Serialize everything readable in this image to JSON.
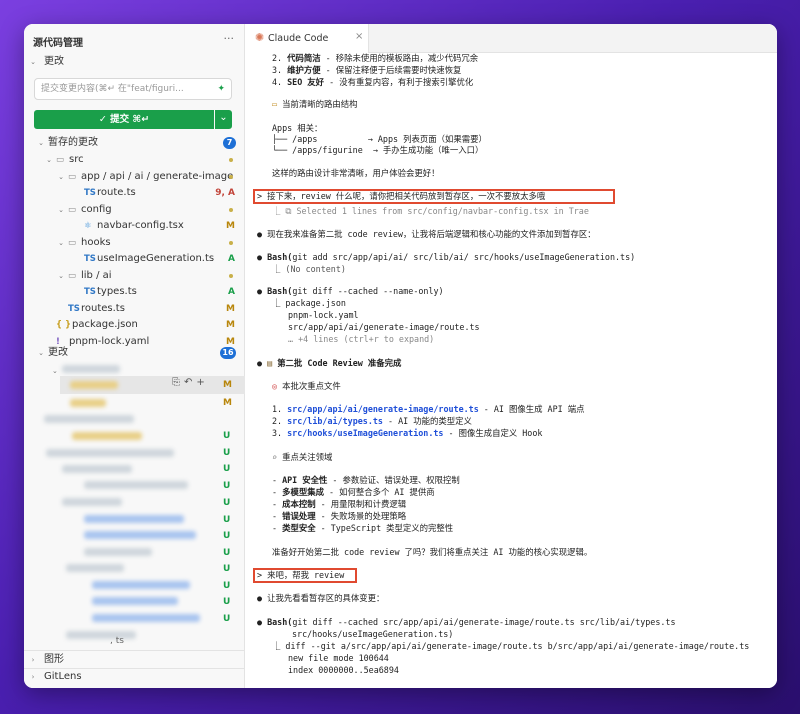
{
  "sidebar": {
    "title": "源代码管理",
    "more": "···",
    "section_changes": "更改",
    "commit_input_placeholder": "提交变更内容(⌘↵ 在\"feat/figuri...",
    "commit_button": "✓ 提交 ⌘↵",
    "commit_arrow": "⌄",
    "staged": {
      "label": "暂存的更改",
      "count": "7"
    },
    "tree": [
      {
        "name": "src",
        "kind": "folder",
        "level": 1
      },
      {
        "name": "app / api / ai / generate-image",
        "kind": "folder",
        "level": 2
      },
      {
        "name": "route.ts",
        "kind": "ts",
        "level": 3,
        "status": "9, A"
      },
      {
        "name": "config",
        "kind": "folder",
        "level": 2
      },
      {
        "name": "navbar-config.tsx",
        "kind": "tsx",
        "level": 3,
        "status": "M"
      },
      {
        "name": "hooks",
        "kind": "folder",
        "level": 2
      },
      {
        "name": "useImageGeneration.ts",
        "kind": "ts",
        "level": 3,
        "status": "A"
      },
      {
        "name": "lib / ai",
        "kind": "folder",
        "level": 2
      },
      {
        "name": "types.ts",
        "kind": "ts",
        "level": 3,
        "status": "A"
      },
      {
        "name": "routes.ts",
        "kind": "ts",
        "level": 2,
        "status": "M"
      },
      {
        "name": "package.json",
        "kind": "json",
        "level": 1,
        "status": "M"
      },
      {
        "name": "pnpm-lock.yaml",
        "kind": "yaml",
        "level": 1,
        "status": "M"
      }
    ],
    "changes": {
      "label": "更改",
      "count": "16"
    },
    "changes_status": [
      "M",
      "M",
      "U",
      "U",
      "U",
      "U",
      "U",
      "U",
      "U",
      "U",
      "U",
      "U",
      "U",
      "U"
    ],
    "row_actions": [
      "⎘",
      "↶",
      "+"
    ],
    "bottom": [
      {
        "label": "图形"
      },
      {
        "label": "GitLens"
      }
    ]
  },
  "tab": {
    "title": "Claude Code",
    "close": "×"
  },
  "terminal": {
    "list_top": [
      {
        "n": "2.",
        "b": "代码简洁",
        "t": " - 移除未使用的模板路由，减少代码冗余"
      },
      {
        "n": "3.",
        "b": "维护方便",
        "t": " - 保留注释便于后续需要时快速恢复"
      },
      {
        "n": "4.",
        "b": "SEO 友好",
        "t": " - 没有重复内容，有利于搜索引擎优化"
      }
    ],
    "route_head": "当前清晰的路由结构",
    "route_lines": [
      "Apps 相关：",
      "├── /apps          → Apps 列表页面（如果需要）",
      "└── /apps/figurine  → 手办生成功能（唯一入口）"
    ],
    "route_summary": "这样的路由设计非常清晰，用户体验会更好！",
    "prompt1": "> 接下来，review 什么呢，请你把相关代码放到暂存区，一次不要放太多哦",
    "selected": "⎿  ⧉ Selected 1 lines from src/config/navbar-config.tsx in Trae",
    "msg1": "● 现在我来准备第二批 code review，让我将后端逻辑和核心功能的文件添加到暂存区：",
    "bash1": "git add src/app/api/ai/ src/lib/ai/ src/hooks/useImageGeneration.ts)",
    "bash_label": "Bash(",
    "bash1_out": "⎿  (No content)",
    "bash2": "git diff --cached --name-only)",
    "bash2_out": [
      "⎿  package.json",
      "pnpm-lock.yaml",
      "src/app/api/ai/generate-image/route.ts",
      "… +4 lines (ctrl+r to expand)"
    ],
    "done_title": "第二批 Code Review 准备完成",
    "focus_head": "本批次重点文件",
    "focus_files": [
      {
        "n": "1.",
        "path": "src/app/api/ai/generate-image/route.ts",
        "desc": " - AI 图像生成 API 端点"
      },
      {
        "n": "2.",
        "path": "src/lib/ai/types.ts",
        "desc": " - AI 功能的类型定义"
      },
      {
        "n": "3.",
        "path": "src/hooks/useImageGeneration.ts",
        "desc": " - 图像生成自定义 Hook"
      }
    ],
    "area_head": "重点关注领域",
    "areas": [
      {
        "b": "API 安全性",
        "t": " - 参数验证、错误处理、权限控制"
      },
      {
        "b": "多模型集成",
        "t": " - 如何整合多个 AI 提供商"
      },
      {
        "b": "成本控制",
        "t": " - 用量限制和计费逻辑"
      },
      {
        "b": "错误处理",
        "t": " - 失败场景的处理策略"
      },
      {
        "b": "类型安全",
        "t": " - TypeScript 类型定义的完整性"
      }
    ],
    "ready": "准备好开始第二批 code review 了吗？我们将重点关注 AI 功能的核心实现逻辑。",
    "prompt2": "> 来吧，帮我 review",
    "msg2": "● 让我先看看暂存区的具体变更：",
    "bash3_a": "git diff --cached src/app/api/ai/generate-image/route.ts src/lib/ai/types.ts",
    "bash3_b": "src/hooks/useImageGeneration.ts)",
    "diff_lines": [
      "⎿  diff --git a/src/app/api/ai/generate-image/route.ts b/src/app/api/ai/generate-image/route.ts",
      "new file mode 100644",
      "index 0000000..5ea6894"
    ]
  },
  "colors": {
    "accent": "#1a9f4a",
    "badge": "#1e70d6",
    "highlight": "#e04a30",
    "claude": "#d97757"
  }
}
